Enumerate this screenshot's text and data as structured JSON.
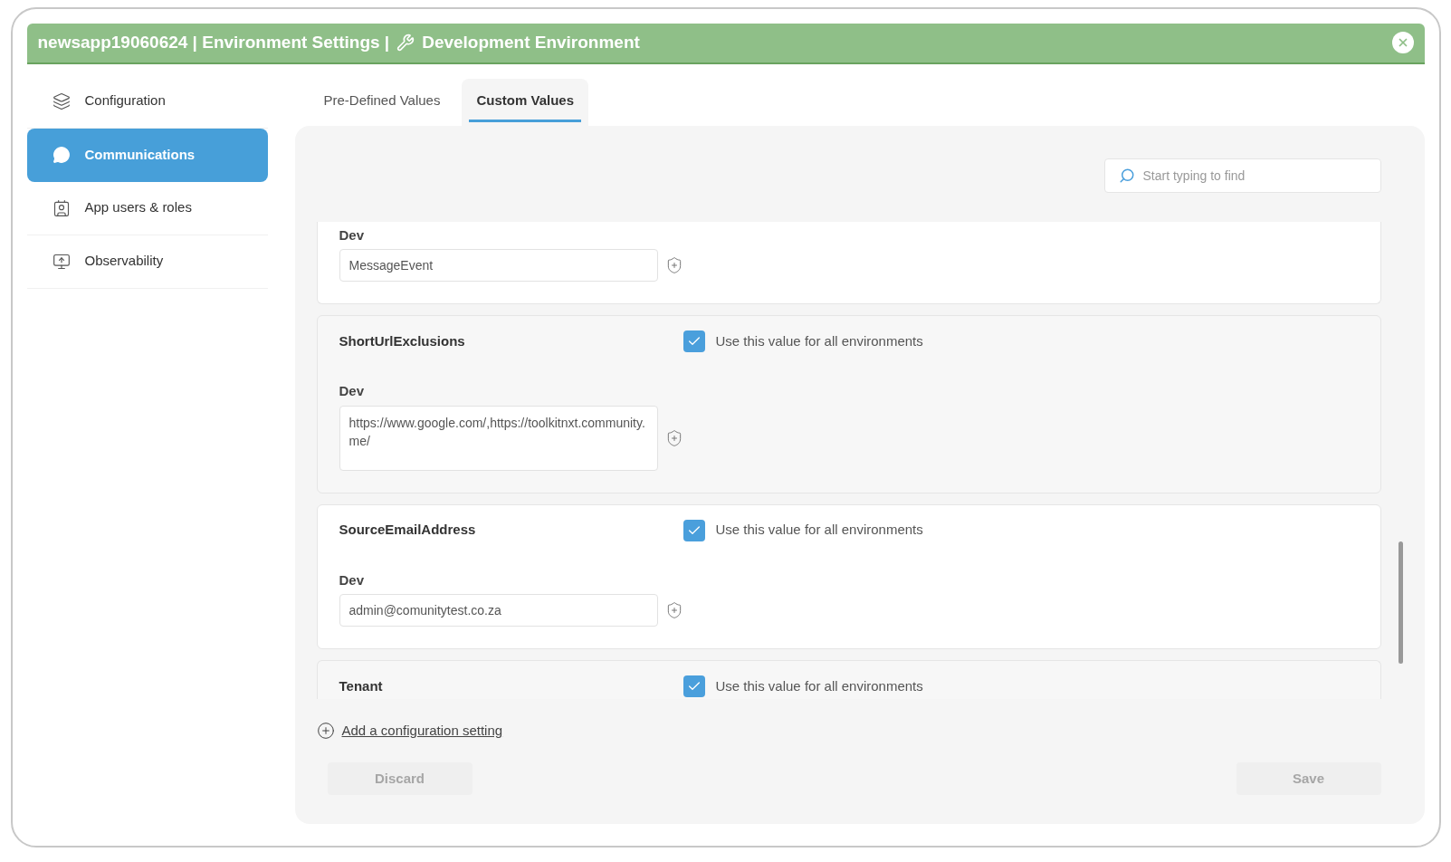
{
  "window": {
    "title_prefix": "newsapp19060624 | Environment Settings |",
    "title_env": "Development Environment"
  },
  "sidebar": {
    "items": [
      {
        "label": "Configuration",
        "selected": false
      },
      {
        "label": "Communications",
        "selected": true
      },
      {
        "label": "App users & roles",
        "selected": false
      },
      {
        "label": "Observability",
        "selected": false
      }
    ]
  },
  "tabs": [
    {
      "label": "Pre-Defined Values",
      "selected": false
    },
    {
      "label": "Custom Values",
      "selected": true
    }
  ],
  "search": {
    "placeholder": "Start typing to find"
  },
  "settings": [
    {
      "env_label": "Dev",
      "value": "MessageEvent",
      "multiline": false
    },
    {
      "name": "ShortUrlExclusions",
      "all_envs_label": "Use this value for all environments",
      "all_envs": true,
      "env_label": "Dev",
      "value": "https://www.google.com/,https://toolkitnxt.community.me/",
      "multiline": true
    },
    {
      "name": "SourceEmailAddress",
      "all_envs_label": "Use this value for all environments",
      "all_envs": true,
      "env_label": "Dev",
      "value": "admin@comunitytest.co.za",
      "multiline": false
    },
    {
      "name": "Tenant",
      "all_envs_label": "Use this value for all environments",
      "all_envs": true
    }
  ],
  "add_link": "Add a configuration setting",
  "buttons": {
    "discard": {
      "label": "Discard",
      "disabled": true
    },
    "save": {
      "label": "Save",
      "disabled": true
    }
  }
}
